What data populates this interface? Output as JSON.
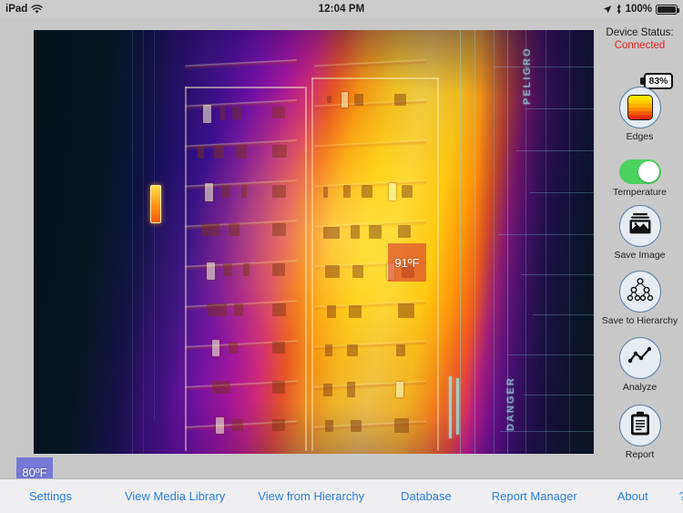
{
  "status_bar": {
    "device": "iPad",
    "wifi_icon": "wifi-icon",
    "time": "12:04 PM",
    "location_icon": "location-arrow-icon",
    "bluetooth_icon": "bluetooth-icon",
    "battery_percent": "100%",
    "battery_icon": "battery-icon"
  },
  "device_panel": {
    "status_label": "Device Status:",
    "status_value": "Connected",
    "status_color": "#e2211c",
    "battery_percent": "83%",
    "battery_icon": "battery-icon"
  },
  "tools": [
    {
      "id": "edges",
      "label": "Edges",
      "icon": "color-palette-icon"
    },
    {
      "id": "temperature",
      "label": "Temperature",
      "icon": "toggle-switch-icon",
      "toggle_on": true,
      "toggle_color": "#4cd25f"
    },
    {
      "id": "save-image",
      "label": "Save Image",
      "icon": "save-image-icon"
    },
    {
      "id": "save-hierarchy",
      "label": "Save to Hierarchy",
      "icon": "hierarchy-tree-icon"
    },
    {
      "id": "analyze",
      "label": "Analyze",
      "icon": "line-chart-icon"
    },
    {
      "id": "report",
      "label": "Report",
      "icon": "clipboard-icon"
    }
  ],
  "thermal_image": {
    "markers": [
      {
        "id": "hot",
        "value": "91ºF",
        "color": "rgba(214,46,46,0.58)"
      },
      {
        "id": "cold",
        "value": "80ºF",
        "color": "rgba(70,70,225,0.62)"
      }
    ],
    "scene_text": [
      {
        "text": "PELIGRO"
      },
      {
        "text": "DANGER"
      }
    ]
  },
  "toolbar": {
    "items": [
      {
        "id": "settings",
        "label": "Settings"
      },
      {
        "id": "view-media-library",
        "label": "View Media Library"
      },
      {
        "id": "view-from-hierarchy",
        "label": "View from Hierarchy"
      },
      {
        "id": "database",
        "label": "Database"
      },
      {
        "id": "report-manager",
        "label": "Report Manager"
      },
      {
        "id": "about",
        "label": "About"
      },
      {
        "id": "help",
        "label": "?"
      }
    ]
  }
}
